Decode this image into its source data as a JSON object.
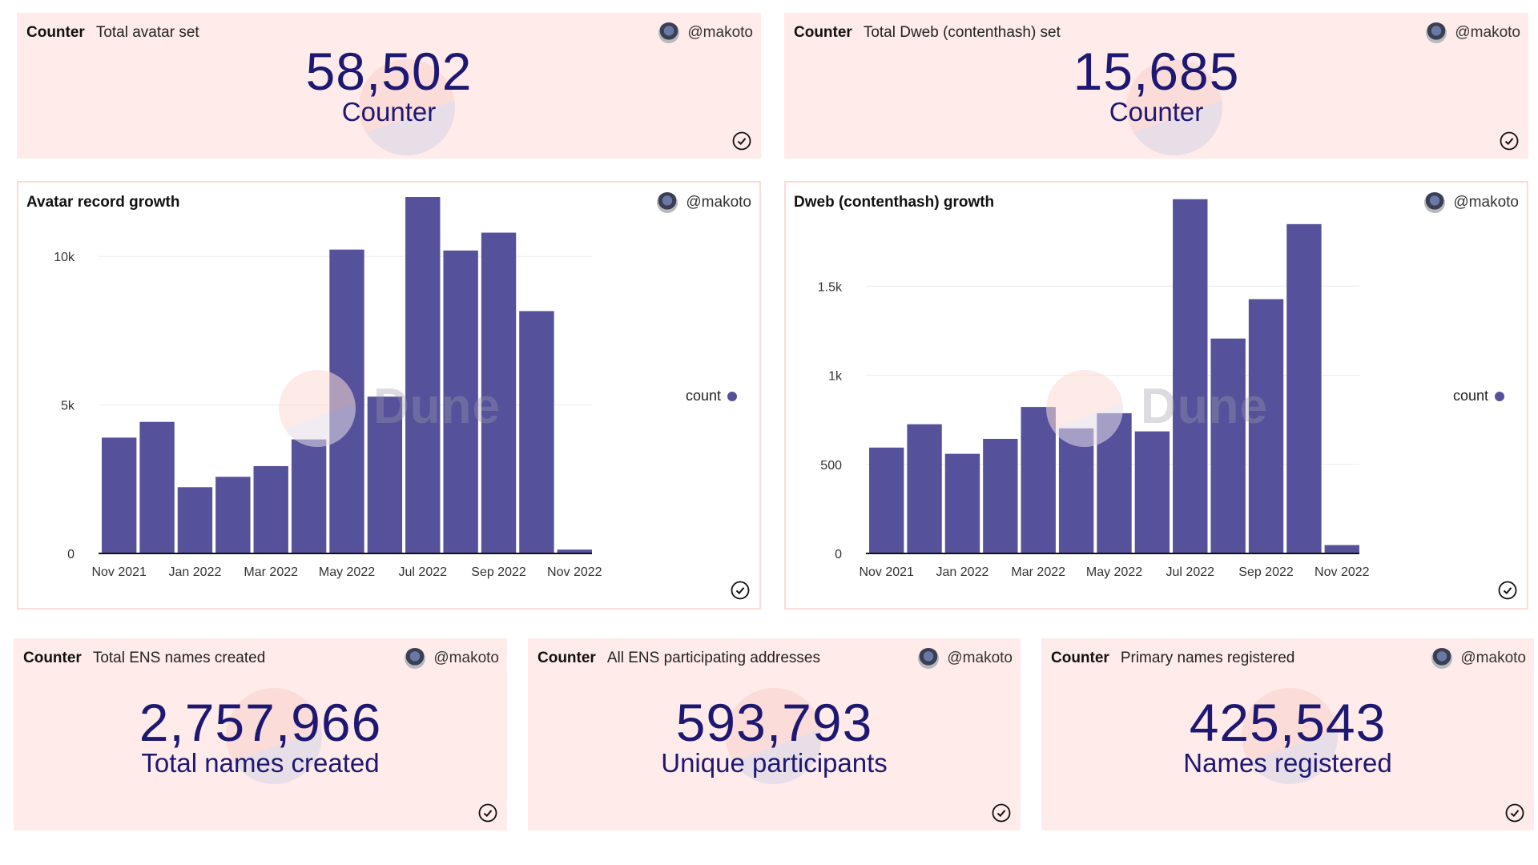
{
  "accent_color": "#1d1872",
  "bar_color": "#55529b",
  "card_background": "#ffebea",
  "author": "@makoto",
  "icons": {
    "avatar": "user-avatar",
    "status": "check-circle-icon"
  },
  "top_counters": [
    {
      "type": "Counter",
      "title": "Total avatar set",
      "value": "58,502",
      "label": "Counter"
    },
    {
      "type": "Counter",
      "title": "Total Dweb (contenthash) set",
      "value": "15,685",
      "label": "Counter"
    }
  ],
  "bottom_counters": [
    {
      "type": "Counter",
      "title": "Total ENS names created",
      "value": "2,757,966",
      "label": "Total names created"
    },
    {
      "type": "Counter",
      "title": "All ENS participating addresses",
      "value": "593,793",
      "label": "Unique participants"
    },
    {
      "type": "Counter",
      "title": "Primary names registered",
      "value": "425,543",
      "label": "Names registered"
    }
  ],
  "watermark": "Dune",
  "chart_data": [
    {
      "type": "bar",
      "title": "Avatar record growth",
      "xlabel": "",
      "ylabel": "",
      "categories": [
        "Nov 2021",
        "Dec 2021",
        "Jan 2022",
        "Feb 2022",
        "Mar 2022",
        "Apr 2022",
        "May 2022",
        "Jun 2022",
        "Jul 2022",
        "Aug 2022",
        "Sep 2022",
        "Oct 2022",
        "Nov 2022"
      ],
      "x_tick_labels": [
        "Nov 2021",
        "Jan 2022",
        "Mar 2022",
        "May 2022",
        "Jul 2022",
        "Sep 2022",
        "Nov 2022"
      ],
      "series": [
        {
          "name": "count",
          "values": [
            3900,
            4430,
            2230,
            2580,
            2940,
            3840,
            10230,
            5280,
            12000,
            10200,
            10800,
            8160,
            130
          ]
        }
      ],
      "y_ticks": [
        0,
        5000,
        10000
      ],
      "y_tick_labels": [
        "0",
        "5k",
        "10k"
      ],
      "ylim": [
        0,
        12000
      ],
      "grid": true,
      "legend": {
        "entries": [
          "count"
        ],
        "position": "right"
      }
    },
    {
      "type": "bar",
      "title": "Dweb (contenthash) growth",
      "xlabel": "",
      "ylabel": "",
      "categories": [
        "Nov 2021",
        "Dec 2021",
        "Jan 2022",
        "Feb 2022",
        "Mar 2022",
        "Apr 2022",
        "May 2022",
        "Jun 2022",
        "Jul 2022",
        "Aug 2022",
        "Sep 2022",
        "Oct 2022",
        "Nov 2022"
      ],
      "x_tick_labels": [
        "Nov 2021",
        "Jan 2022",
        "Mar 2022",
        "May 2022",
        "Jul 2022",
        "Sep 2022",
        "Nov 2022"
      ],
      "series": [
        {
          "name": "count",
          "values": [
            594,
            725,
            559,
            643,
            822,
            702,
            787,
            685,
            1988,
            1206,
            1427,
            1848,
            47
          ]
        }
      ],
      "y_ticks": [
        0,
        500,
        1000,
        1500
      ],
      "y_tick_labels": [
        "0",
        "500",
        "1k",
        "1.5k"
      ],
      "ylim": [
        0,
        2000
      ],
      "grid": true,
      "legend": {
        "entries": [
          "count"
        ],
        "position": "right"
      }
    }
  ]
}
